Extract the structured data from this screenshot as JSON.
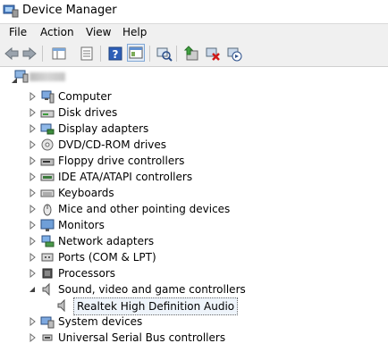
{
  "window": {
    "title": "Device Manager"
  },
  "menu": [
    "File",
    "Action",
    "View",
    "Help"
  ],
  "toolbar": {
    "icons": [
      "back-arrow-icon",
      "forward-arrow-icon",
      "show-hide-tree-icon",
      "properties-icon",
      "help-icon",
      "view-icon",
      "scan-hardware-icon",
      "update-driver-icon",
      "uninstall-icon",
      "enable-device-icon"
    ]
  },
  "tree": {
    "root_label": "",
    "categories": [
      {
        "label": "Computer",
        "icon": "computer-icon"
      },
      {
        "label": "Disk drives",
        "icon": "disk-drive-icon"
      },
      {
        "label": "Display adapters",
        "icon": "display-adapter-icon"
      },
      {
        "label": "DVD/CD-ROM drives",
        "icon": "dvd-drive-icon"
      },
      {
        "label": "Floppy drive controllers",
        "icon": "floppy-controller-icon"
      },
      {
        "label": "IDE ATA/ATAPI controllers",
        "icon": "ide-controller-icon"
      },
      {
        "label": "Keyboards",
        "icon": "keyboard-icon"
      },
      {
        "label": "Mice and other pointing devices",
        "icon": "mouse-icon"
      },
      {
        "label": "Monitors",
        "icon": "monitor-icon"
      },
      {
        "label": "Network adapters",
        "icon": "network-adapter-icon"
      },
      {
        "label": "Ports (COM & LPT)",
        "icon": "port-icon"
      },
      {
        "label": "Processors",
        "icon": "processor-icon"
      },
      {
        "label": "Sound, video and game controllers",
        "icon": "speaker-icon",
        "expanded": true,
        "children": [
          {
            "label": "Realtek High Definition Audio",
            "icon": "speaker-icon",
            "selected": true
          }
        ]
      },
      {
        "label": "System devices",
        "icon": "system-device-icon"
      },
      {
        "label": "Universal Serial Bus controllers",
        "icon": "usb-icon"
      }
    ]
  }
}
